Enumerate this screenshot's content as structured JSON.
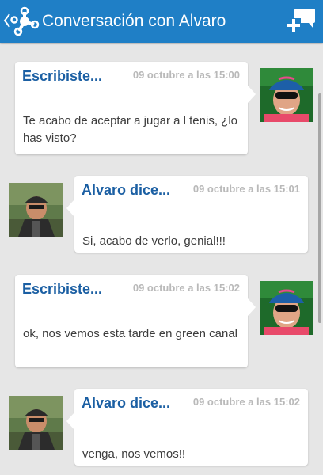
{
  "header": {
    "title": "Conversación con Alvaro",
    "background": "#1f7fc6"
  },
  "icons": {
    "back": "chevron-left-icon",
    "logo": "app-logo-icon",
    "compose": "new-message-icon"
  },
  "messages": [
    {
      "sender": "Escribiste...",
      "timestamp": "09 octubre a las 15:00",
      "text": "Te acabo de aceptar a jugar a l tenis, ¿lo has visto?",
      "mine": true
    },
    {
      "sender": "Alvaro dice...",
      "timestamp": "09 octubre a las 15:01",
      "text": "Si, acabo de verlo, genial!!!",
      "mine": false
    },
    {
      "sender": "Escribiste...",
      "timestamp": "09 octubre a las 15:02",
      "text": "ok, nos vemos esta tarde en green canal",
      "mine": true
    },
    {
      "sender": "Alvaro dice...",
      "timestamp": "09 octubre a las 15:02",
      "text": "venga, nos vemos!!",
      "mine": false
    }
  ],
  "colors": {
    "sender_name": "#1b5fa3",
    "timestamp": "#b9b9b9",
    "background": "#e6e6e6"
  }
}
